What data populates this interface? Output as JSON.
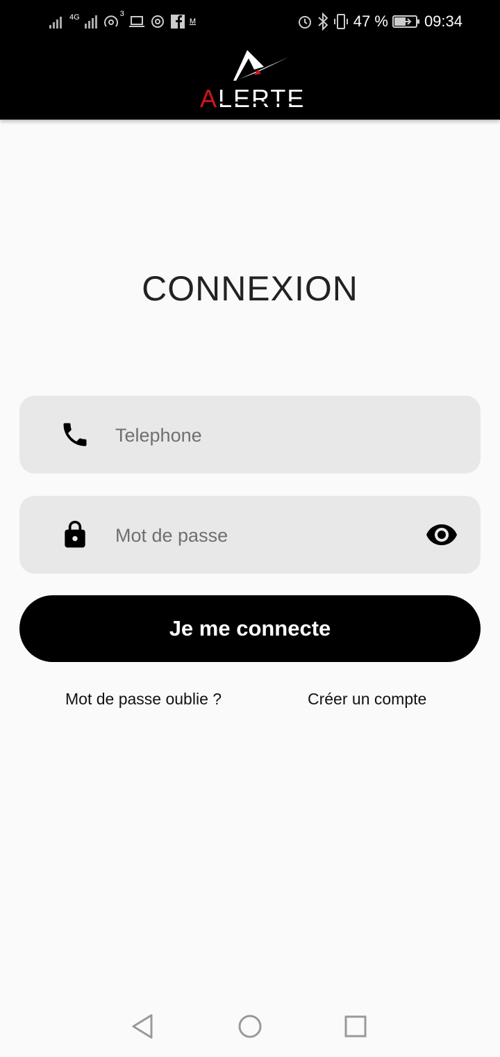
{
  "status_bar": {
    "network_type": "4G",
    "hotspot_count": "3",
    "messenger_badge": "M",
    "battery_percent": "47 %",
    "time": "09:34"
  },
  "app_bar": {
    "logo_text": "ALERTE",
    "logo_accent_color": "#d4151c"
  },
  "login": {
    "title": "CONNEXION",
    "phone_placeholder": "Telephone",
    "password_placeholder": "Mot de passe",
    "submit_label": "Je me connecte",
    "forgot_password": "Mot de passe oublie ?",
    "create_account": "Créer un compte"
  },
  "icons": {
    "phone": "phone-icon",
    "lock": "lock-icon",
    "visibility": "eye-icon"
  },
  "colors": {
    "header_bg": "#000000",
    "field_bg": "#e8e8e8",
    "button_bg": "#000000",
    "page_bg": "#fafafa"
  }
}
